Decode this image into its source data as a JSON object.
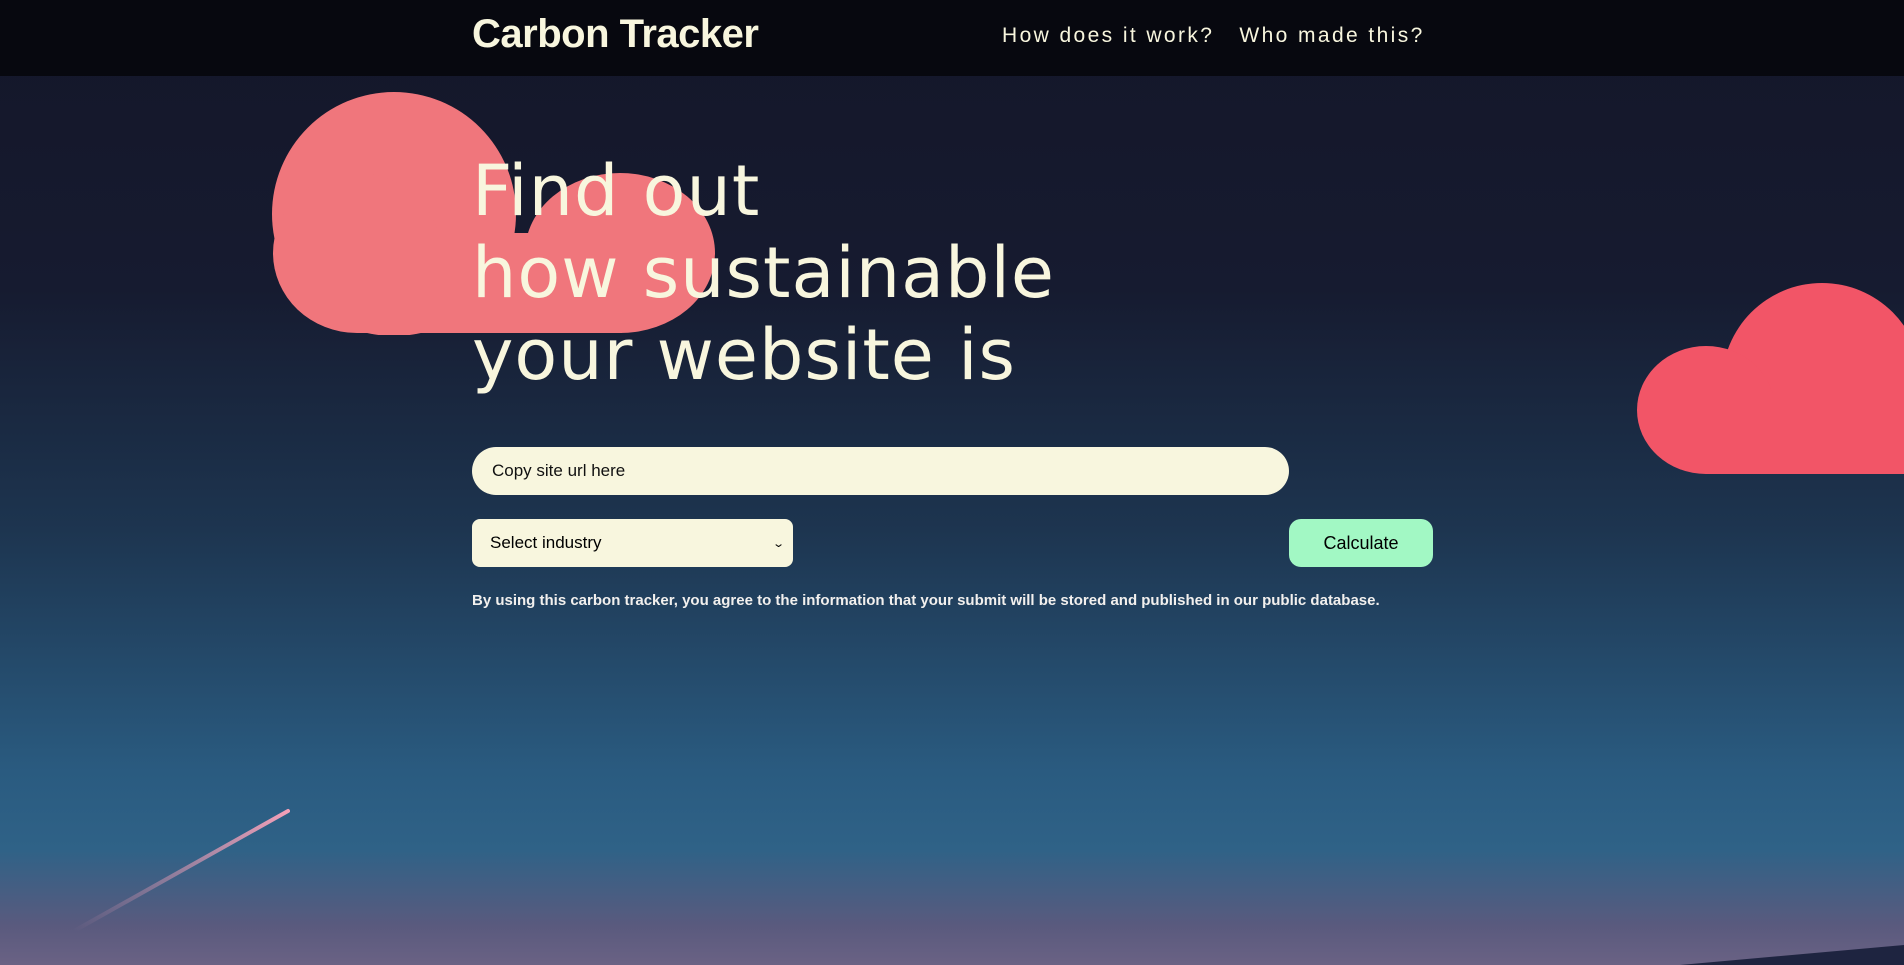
{
  "header": {
    "brand": "Carbon Tracker",
    "nav": [
      {
        "label": "How does it work?"
      },
      {
        "label": "Who made this?"
      }
    ]
  },
  "hero": {
    "lines": [
      "Find out",
      "how sustainable",
      "your website is"
    ]
  },
  "form": {
    "url_placeholder": "Copy site url here",
    "industry_selected": "Select industry",
    "calculate_label": "Calculate",
    "disclaimer": "By using this carbon tracker, you agree to the information that your submit will be stored and published in our public database."
  },
  "colors": {
    "navbar_bg": "#07080f",
    "text_cream": "#f8f6de",
    "cloud_left": "#f0767c",
    "cloud_right": "#f25567",
    "calculate_bg": "#a2f8c4",
    "input_bg": "#f8f6de"
  },
  "icons": {
    "select_chevron": "chevron-down-icon"
  }
}
